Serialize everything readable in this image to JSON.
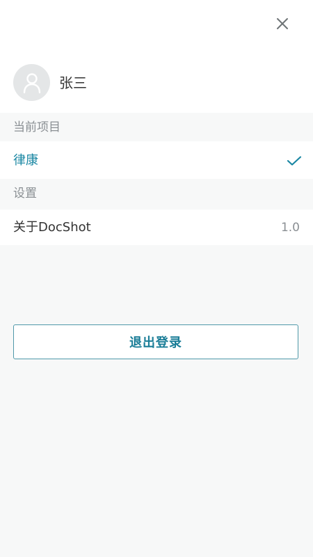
{
  "colors": {
    "accent": "#1a87a3",
    "page_background": "#f7f8f8",
    "card_background": "#ffffff",
    "muted_text": "#8a8f93"
  },
  "header": {
    "close_icon": "close-icon"
  },
  "user": {
    "avatar_icon": "user-avatar-icon",
    "name": "张三"
  },
  "current_project": {
    "section_title": "当前项目",
    "selected_project": "律康",
    "selected_icon": "checkmark-icon"
  },
  "settings": {
    "section_title": "设置",
    "about_label": "关于DocShot",
    "version": "1.0"
  },
  "logout": {
    "label": "退出登录"
  }
}
